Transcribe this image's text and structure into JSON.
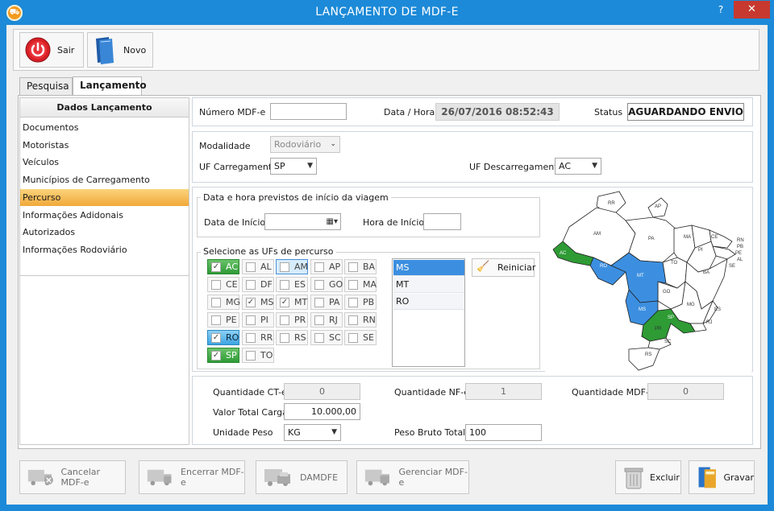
{
  "window": {
    "title": "LANÇAMENTO DE MDF-E",
    "help": "?",
    "close": "✕"
  },
  "toolbar": {
    "sair": "Sair",
    "novo": "Novo"
  },
  "tabs": [
    {
      "label": "Pesquisa"
    },
    {
      "label": "Lançamento"
    }
  ],
  "sidebar": {
    "header": "Dados Lançamento",
    "items": [
      {
        "label": "Documentos"
      },
      {
        "label": "Motoristas"
      },
      {
        "label": "Veículos"
      },
      {
        "label": "Municípios de Carregamento"
      },
      {
        "label": "Percurso"
      },
      {
        "label": "Informações Adidonais"
      },
      {
        "label": "Autorizados"
      },
      {
        "label": "Informações Rodoviário"
      }
    ],
    "selected": "Percurso"
  },
  "header_fields": {
    "numero_label": "Número MDF-e",
    "numero_value": "",
    "data_label": "Data / Hora",
    "data_value": "26/07/2016 08:52:43",
    "status_label": "Status",
    "status_value": "AGUARDANDO ENVIO"
  },
  "modal": {
    "modalidade_label": "Modalidade",
    "modalidade_value": "Rodoviário",
    "uf_carreg_label": "UF Carregamento",
    "uf_carreg_value": "SP",
    "uf_descarreg_label": "UF Descarregamento",
    "uf_descarreg_value": "AC"
  },
  "viagem": {
    "legend": "Data e hora previstos de início da viagem",
    "data_label": "Data de Início",
    "data_value": "",
    "hora_label": "Hora de Início",
    "hora_value": ""
  },
  "ufs": {
    "legend": "Selecione as UFs de percurso",
    "grid": [
      [
        "AC",
        "AL",
        "AM",
        "AP",
        "BA"
      ],
      [
        "CE",
        "DF",
        "ES",
        "GO",
        "MA"
      ],
      [
        "MG",
        "MS",
        "MT",
        "PA",
        "PB"
      ],
      [
        "PE",
        "PI",
        "PR",
        "RJ",
        "RN"
      ],
      [
        "RO",
        "RR",
        "RS",
        "SC",
        "SE"
      ],
      [
        "SP",
        "TO"
      ]
    ],
    "checked": [
      "AC",
      "MS",
      "MT",
      "RO",
      "SP"
    ],
    "green": [
      "AC",
      "SP"
    ],
    "blue": [
      "RO"
    ],
    "focused": "AM",
    "selected_list": [
      "MS",
      "MT",
      "RO"
    ],
    "reiniciar": "Reiniciar"
  },
  "map_labels": [
    "RR",
    "AP",
    "AM",
    "PA",
    "MA",
    "CE",
    "RN",
    "PB",
    "PE",
    "AL",
    "SE",
    "PI",
    "AC",
    "RO",
    "MT",
    "TO",
    "BA",
    "GO",
    "MS",
    "MG",
    "ES",
    "SP",
    "RJ",
    "PR",
    "SC",
    "RS"
  ],
  "colors": {
    "accent": "#1c8ad8",
    "green": "#2e9b35",
    "blue": "#3c8fe0",
    "highlight": "#f1a93a",
    "close": "#c7392e"
  },
  "totals": {
    "qtd_cte_label": "Quantidade CT-e",
    "qtd_cte_value": "0",
    "qtd_nfe_label": "Quantidade NF-e",
    "qtd_nfe_value": "1",
    "qtd_mdfe_label": "Quantidade MDF-e",
    "qtd_mdfe_value": "0",
    "valor_label": "Valor Total Carga",
    "valor_value": "10.000,00",
    "unidade_label": "Unidade Peso",
    "unidade_value": "KG",
    "peso_label": "Peso Bruto Total",
    "peso_value": "100"
  },
  "footer": {
    "cancelar": "Cancelar MDF-e",
    "encerrar": "Encerrar MDF-e",
    "damdfe": "DAMDFE",
    "gerenciar": "Gerenciar MDF-e",
    "excluir": "Excluir",
    "gravar": "Gravar"
  }
}
